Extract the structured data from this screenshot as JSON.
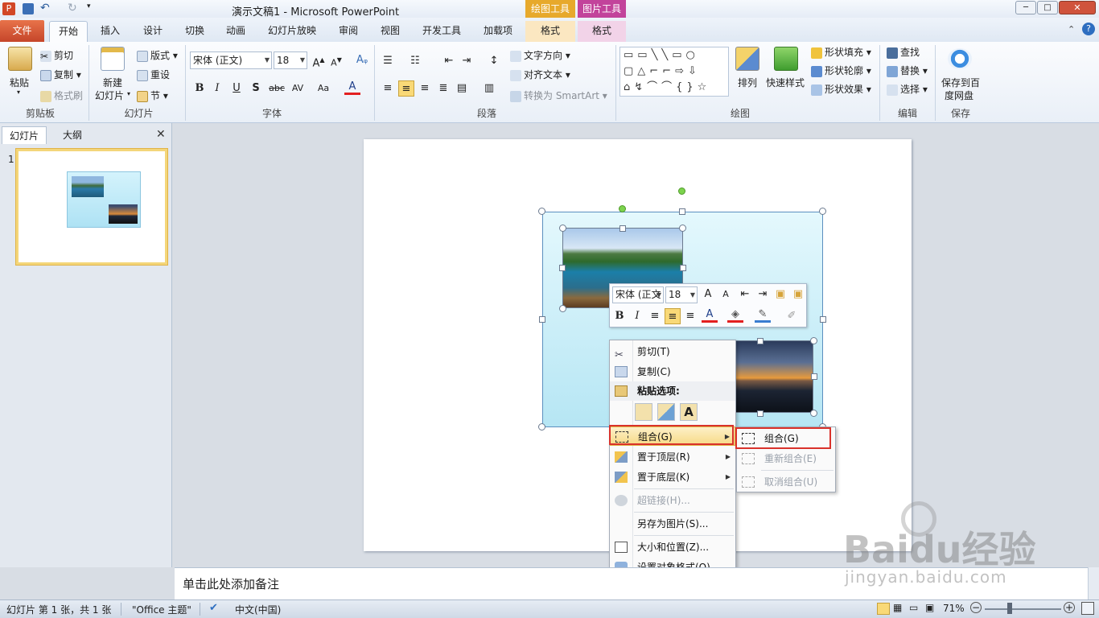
{
  "window": {
    "title": "演示文稿1 - Microsoft PowerPoint",
    "context_tools": [
      "绘图工具",
      "图片工具"
    ],
    "controls": {
      "minimize": "─",
      "maximize": "□",
      "close": "✕"
    }
  },
  "tabs": [
    "文件",
    "开始",
    "插入",
    "设计",
    "切换",
    "动画",
    "幻灯片放映",
    "审阅",
    "视图",
    "开发工具",
    "加载项",
    "格式",
    "格式"
  ],
  "ribbon": {
    "clipboard": {
      "paste": "粘贴",
      "cut": "剪切",
      "copy": "复制",
      "format_painter": "格式刷",
      "label": "剪贴板"
    },
    "slides": {
      "new_slide": "新建\n幻灯片",
      "new_slide_line1": "新建",
      "new_slide_line2": "幻灯片",
      "layout": "版式",
      "reset": "重设",
      "section": "节",
      "label": "幻灯片"
    },
    "font": {
      "font_name": "宋体 (正文)",
      "font_size": "18",
      "label": "字体",
      "buttons": [
        "B",
        "I",
        "U",
        "S",
        "abc",
        "AV",
        "Aa",
        "A"
      ]
    },
    "paragraph": {
      "text_direction": "文字方向",
      "align_text": "对齐文本",
      "smartart": "转换为 SmartArt",
      "label": "段落"
    },
    "drawing": {
      "arrange": "排列",
      "quick_styles": "快速样式",
      "shape_fill": "形状填充",
      "shape_outline": "形状轮廓",
      "shape_effects": "形状效果",
      "label": "绘图"
    },
    "editing": {
      "find": "查找",
      "replace": "替换",
      "select": "选择",
      "label": "编辑"
    },
    "save": {
      "save_baidu": "保存到百\n度网盘",
      "save_line1": "保存到百",
      "save_line2": "度网盘",
      "label": "保存"
    }
  },
  "left_panel": {
    "tabs": [
      "幻灯片",
      "大纲"
    ],
    "slide_number": "1"
  },
  "mini_toolbar": {
    "font_name": "宋体 (正文",
    "font_size": "18"
  },
  "context_menu": {
    "items": [
      {
        "label": "剪切(T)",
        "icon": "scissors-icon",
        "enabled": true
      },
      {
        "label": "复制(C)",
        "icon": "copy-icon",
        "enabled": true
      },
      {
        "label": "粘贴选项:",
        "icon": "paste-icon",
        "enabled": true
      },
      {
        "label": "组合(G)",
        "icon": "group-icon",
        "enabled": true
      },
      {
        "label": "置于顶层(R)",
        "icon": "bring-front-icon",
        "enabled": true
      },
      {
        "label": "置于底层(K)",
        "icon": "send-back-icon",
        "enabled": true
      },
      {
        "label": "超链接(H)...",
        "icon": "hyperlink-icon",
        "enabled": false
      },
      {
        "label": "另存为图片(S)...",
        "icon": "",
        "enabled": true
      },
      {
        "label": "大小和位置(Z)...",
        "icon": "size-icon",
        "enabled": true
      },
      {
        "label": "设置对象格式(O)...",
        "icon": "format-object-icon",
        "enabled": true
      }
    ]
  },
  "submenu": {
    "items": [
      {
        "label": "组合(G)",
        "enabled": true
      },
      {
        "label": "重新组合(E)",
        "enabled": false
      },
      {
        "label": "取消组合(U)",
        "enabled": false
      }
    ]
  },
  "notes": {
    "placeholder": "单击此处添加备注"
  },
  "status": {
    "slide_info": "幻灯片 第 1 张，共 1 张",
    "theme": "\"Office 主题\"",
    "language": "中文(中国)",
    "zoom": "71%"
  },
  "watermark": {
    "brand": "Baidu经验",
    "url": "jingyan.baidu.com"
  },
  "colors": {
    "file_tab": "#d15a35",
    "drawing_tools": "#e7a92c",
    "picture_tools": "#c2439b",
    "highlight_box": "#d9322b",
    "selection_fill": "#c9eef9"
  }
}
